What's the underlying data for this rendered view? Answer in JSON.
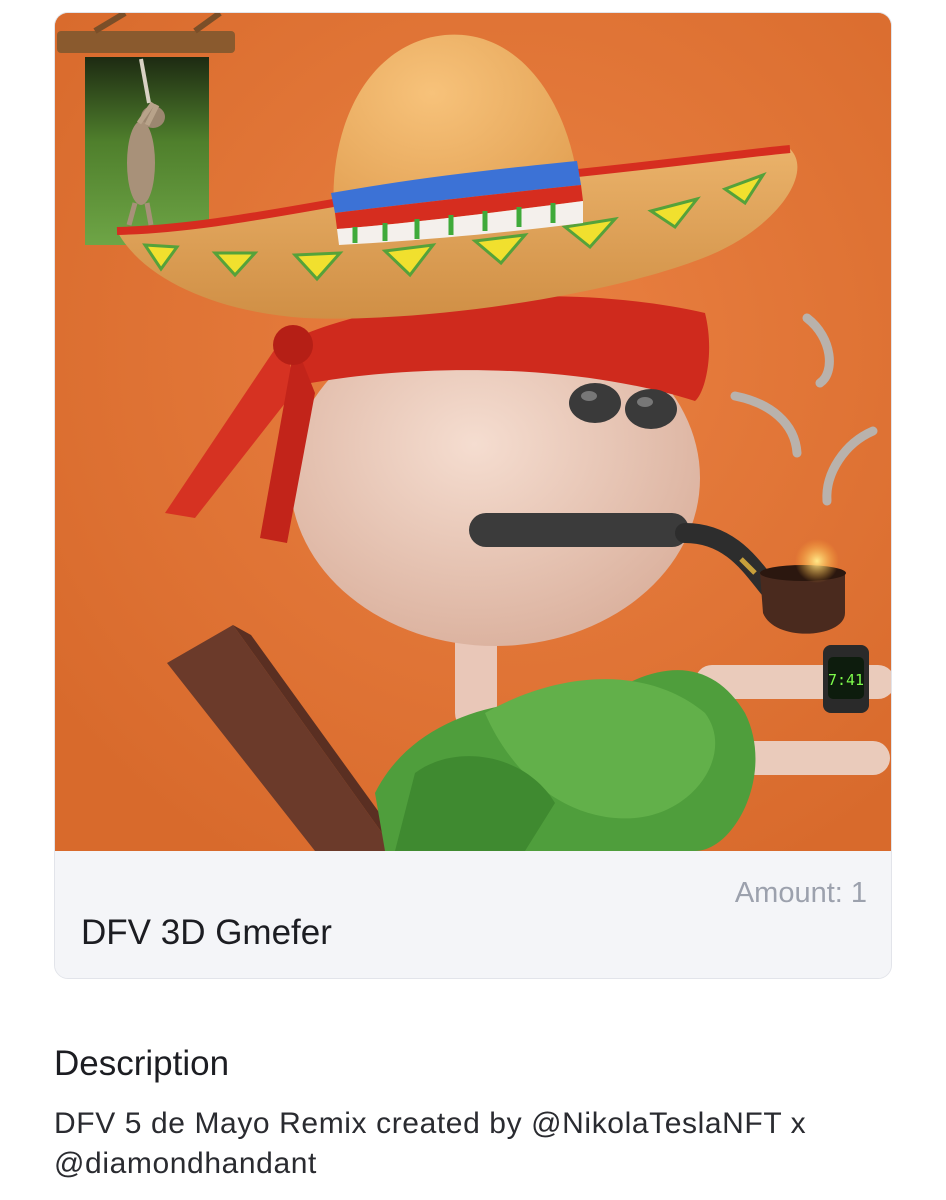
{
  "nft": {
    "amount_text": "Amount: 1",
    "title": "DFV 3D Gmefer",
    "watch_time": "7:41"
  },
  "description": {
    "heading": "Description",
    "text": "DFV 5 de Mayo Remix created by @NikolaTeslaNFT x @diamondhandant"
  },
  "colors": {
    "art_background": "#e07636",
    "card_background": "#f4f5f8",
    "amount_text": "#9ca1ad",
    "title_text": "#1c1d22"
  }
}
